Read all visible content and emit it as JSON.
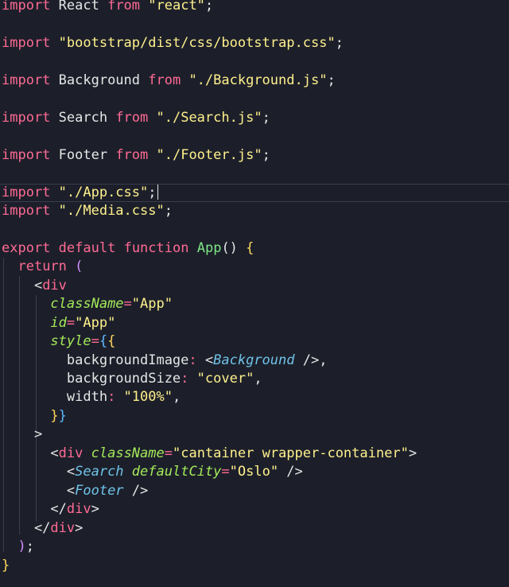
{
  "editor": {
    "colors": {
      "background": "#1c1f2a",
      "keyword": "#ff6a93",
      "string": "#fff08c",
      "function": "#7ee787",
      "attribute": "#a4e95a",
      "component": "#6fc3e8"
    },
    "lines": [
      {
        "tokens": [
          {
            "t": "import",
            "c": "kw"
          },
          {
            "t": " React ",
            "c": "id"
          },
          {
            "t": "from",
            "c": "kw"
          },
          {
            "t": " \"react\"",
            "c": "str"
          },
          {
            "t": ";",
            "c": "pun"
          }
        ]
      },
      {
        "tokens": []
      },
      {
        "tokens": [
          {
            "t": "import",
            "c": "kw"
          },
          {
            "t": " \"bootstrap/dist/css/bootstrap.css\"",
            "c": "str"
          },
          {
            "t": ";",
            "c": "pun"
          }
        ]
      },
      {
        "tokens": []
      },
      {
        "tokens": [
          {
            "t": "import",
            "c": "kw"
          },
          {
            "t": " Background ",
            "c": "id"
          },
          {
            "t": "from",
            "c": "kw"
          },
          {
            "t": " \"./Background.js\"",
            "c": "str"
          },
          {
            "t": ";",
            "c": "pun"
          }
        ]
      },
      {
        "tokens": []
      },
      {
        "tokens": [
          {
            "t": "import",
            "c": "kw"
          },
          {
            "t": " Search ",
            "c": "id"
          },
          {
            "t": "from",
            "c": "kw"
          },
          {
            "t": " \"./Search.js\"",
            "c": "str"
          },
          {
            "t": ";",
            "c": "pun"
          }
        ]
      },
      {
        "tokens": []
      },
      {
        "tokens": [
          {
            "t": "import",
            "c": "kw"
          },
          {
            "t": " Footer ",
            "c": "id"
          },
          {
            "t": "from",
            "c": "kw"
          },
          {
            "t": " \"./Footer.js\"",
            "c": "str"
          },
          {
            "t": ";",
            "c": "pun"
          }
        ]
      },
      {
        "tokens": []
      },
      {
        "tokens": [
          {
            "t": "import",
            "c": "kw"
          },
          {
            "t": " \"./App.css\"",
            "c": "str"
          },
          {
            "t": ";",
            "c": "pun"
          }
        ],
        "current": true
      },
      {
        "tokens": [
          {
            "t": "import",
            "c": "kw"
          },
          {
            "t": " \"./Media.css\"",
            "c": "str"
          },
          {
            "t": ";",
            "c": "pun"
          }
        ]
      },
      {
        "tokens": []
      },
      {
        "tokens": [
          {
            "t": "export",
            "c": "kw"
          },
          {
            "t": " ",
            "c": "id"
          },
          {
            "t": "default",
            "c": "kw"
          },
          {
            "t": " ",
            "c": "id"
          },
          {
            "t": "function",
            "c": "kw"
          },
          {
            "t": " ",
            "c": "id"
          },
          {
            "t": "App",
            "c": "fn"
          },
          {
            "t": "()",
            "c": "pun"
          },
          {
            "t": " {",
            "c": "brace"
          }
        ]
      },
      {
        "tokens": [
          {
            "t": "  ",
            "c": "id"
          },
          {
            "t": "return",
            "c": "kw"
          },
          {
            "t": " (",
            "c": "brace2"
          }
        ]
      },
      {
        "tokens": [
          {
            "t": "    <",
            "c": "pun"
          },
          {
            "t": "div",
            "c": "kw"
          }
        ]
      },
      {
        "tokens": [
          {
            "t": "      ",
            "c": "id"
          },
          {
            "t": "className",
            "c": "attr"
          },
          {
            "t": "=",
            "c": "op"
          },
          {
            "t": "\"App\"",
            "c": "str"
          }
        ]
      },
      {
        "tokens": [
          {
            "t": "      ",
            "c": "id"
          },
          {
            "t": "id",
            "c": "attr"
          },
          {
            "t": "=",
            "c": "op"
          },
          {
            "t": "\"App\"",
            "c": "str"
          }
        ]
      },
      {
        "tokens": [
          {
            "t": "      ",
            "c": "id"
          },
          {
            "t": "style",
            "c": "attr"
          },
          {
            "t": "=",
            "c": "op"
          },
          {
            "t": "{",
            "c": "brace3"
          },
          {
            "t": "{",
            "c": "brace"
          }
        ]
      },
      {
        "tokens": [
          {
            "t": "        backgroundImage",
            "c": "id"
          },
          {
            "t": ":",
            "c": "op"
          },
          {
            "t": " <",
            "c": "pun"
          },
          {
            "t": "Background",
            "c": "comp"
          },
          {
            "t": " />",
            "c": "pun"
          },
          {
            "t": ",",
            "c": "pun"
          }
        ]
      },
      {
        "tokens": [
          {
            "t": "        backgroundSize",
            "c": "id"
          },
          {
            "t": ":",
            "c": "op"
          },
          {
            "t": " \"cover\"",
            "c": "str"
          },
          {
            "t": ",",
            "c": "pun"
          }
        ]
      },
      {
        "tokens": [
          {
            "t": "        width",
            "c": "id"
          },
          {
            "t": ":",
            "c": "op"
          },
          {
            "t": " \"100%\"",
            "c": "str"
          },
          {
            "t": ",",
            "c": "pun"
          }
        ]
      },
      {
        "tokens": [
          {
            "t": "      ",
            "c": "id"
          },
          {
            "t": "}",
            "c": "brace"
          },
          {
            "t": "}",
            "c": "brace3"
          }
        ]
      },
      {
        "tokens": [
          {
            "t": "    >",
            "c": "pun"
          }
        ]
      },
      {
        "tokens": [
          {
            "t": "      <",
            "c": "pun"
          },
          {
            "t": "div",
            "c": "kw"
          },
          {
            "t": " ",
            "c": "id"
          },
          {
            "t": "className",
            "c": "attr"
          },
          {
            "t": "=",
            "c": "op"
          },
          {
            "t": "\"cantainer wrapper-container\"",
            "c": "str"
          },
          {
            "t": ">",
            "c": "pun"
          }
        ]
      },
      {
        "tokens": [
          {
            "t": "        <",
            "c": "pun"
          },
          {
            "t": "Search",
            "c": "comp"
          },
          {
            "t": " ",
            "c": "id"
          },
          {
            "t": "defaultCity",
            "c": "attr"
          },
          {
            "t": "=",
            "c": "op"
          },
          {
            "t": "\"Oslo\"",
            "c": "str"
          },
          {
            "t": " />",
            "c": "pun"
          }
        ]
      },
      {
        "tokens": [
          {
            "t": "        <",
            "c": "pun"
          },
          {
            "t": "Footer",
            "c": "comp"
          },
          {
            "t": " />",
            "c": "pun"
          }
        ]
      },
      {
        "tokens": [
          {
            "t": "      </",
            "c": "pun"
          },
          {
            "t": "div",
            "c": "kw"
          },
          {
            "t": ">",
            "c": "pun"
          }
        ]
      },
      {
        "tokens": [
          {
            "t": "    </",
            "c": "pun"
          },
          {
            "t": "div",
            "c": "kw"
          },
          {
            "t": ">",
            "c": "pun"
          }
        ]
      },
      {
        "tokens": [
          {
            "t": "  ",
            "c": "id"
          },
          {
            "t": ")",
            "c": "brace2"
          },
          {
            "t": ";",
            "c": "pun"
          }
        ]
      },
      {
        "tokens": [
          {
            "t": "}",
            "c": "brace"
          }
        ]
      }
    ]
  }
}
